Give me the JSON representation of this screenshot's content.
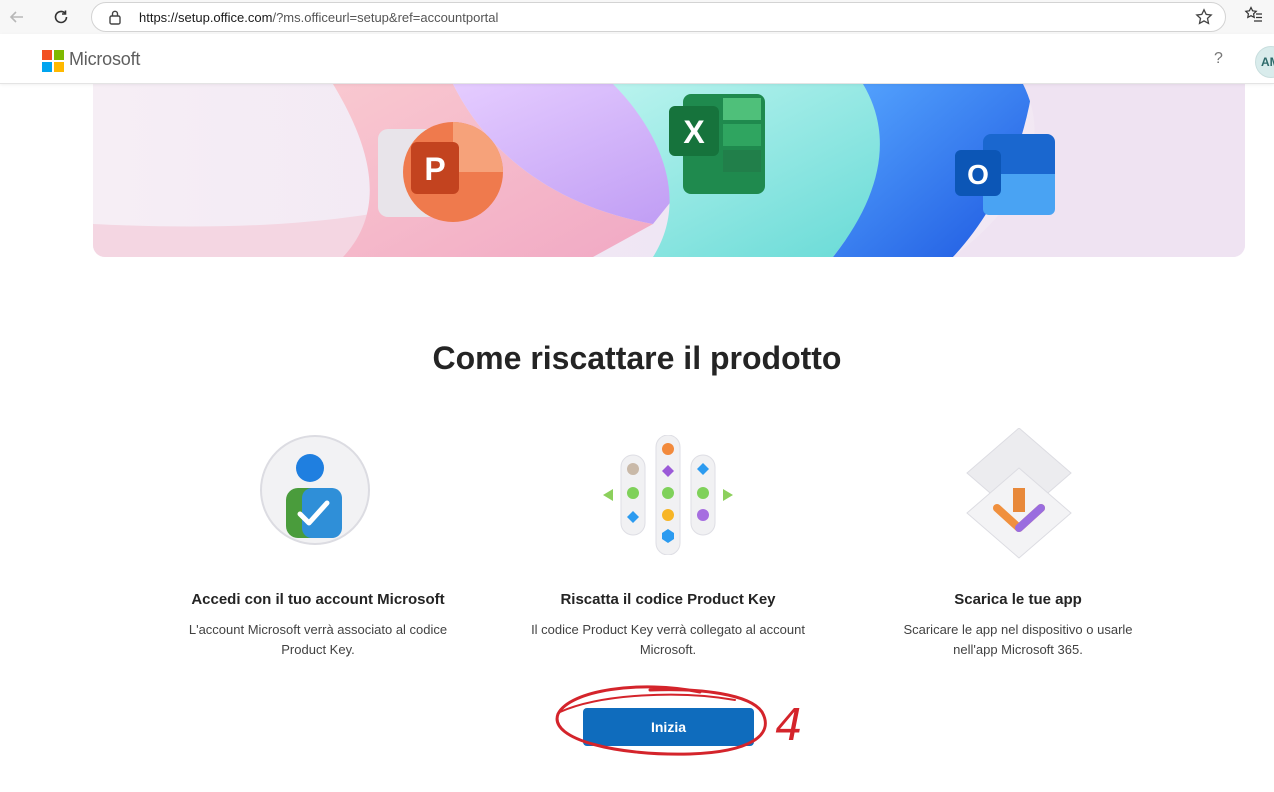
{
  "browser": {
    "url_host": "https://setup.office.com",
    "url_path": "/?ms.officeurl=setup&ref=accountportal"
  },
  "header": {
    "brand": "Microsoft",
    "help": "?",
    "avatar_initials": "AM"
  },
  "hero": {
    "apps": [
      {
        "letter": "P",
        "name": "PowerPoint"
      },
      {
        "letter": "X",
        "name": "Excel"
      },
      {
        "letter": "O",
        "name": "Outlook"
      }
    ]
  },
  "main": {
    "title": "Come riscattare il prodotto",
    "steps": [
      {
        "title": "Accedi con il tuo account Microsoft",
        "desc_line1": "L'account Microsoft verrà associato al codice",
        "desc_line2": "Product Key."
      },
      {
        "title": "Riscatta il codice Product Key",
        "desc_line1": "Il codice Product Key verrà collegato al account",
        "desc_line2": "Microsoft."
      },
      {
        "title": "Scarica le tue app",
        "desc_line1": "Scaricare le app nel dispositivo o usarle",
        "desc_line2": "nell'app Microsoft 365."
      }
    ],
    "cta_label": "Inizia"
  },
  "annotation": {
    "number": "4",
    "color": "#d4242b"
  },
  "colors": {
    "accent": "#0f6cbd",
    "logo_red": "#f25022",
    "logo_green": "#7fba00",
    "logo_blue": "#00a4ef",
    "logo_yellow": "#ffb900"
  }
}
